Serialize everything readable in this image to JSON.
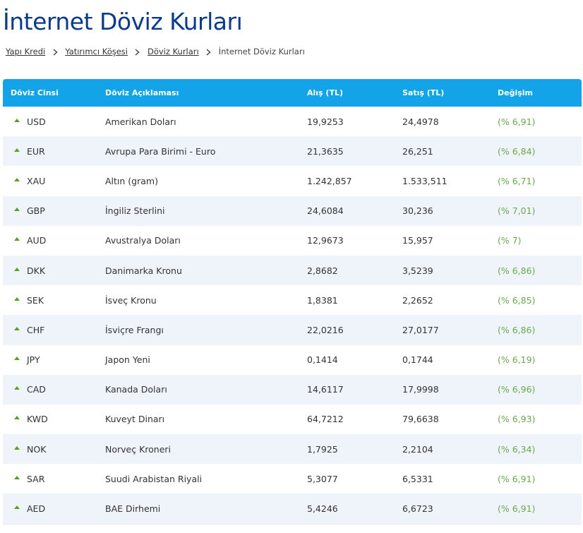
{
  "page": {
    "title": "İnternet Döviz Kurları"
  },
  "breadcrumb": {
    "items": [
      "Yapı Kredi",
      "Yatırımcı Köşesi",
      "Döviz Kurları"
    ],
    "current": "İnternet Döviz Kurları"
  },
  "table": {
    "headers": {
      "code": "Döviz Cinsi",
      "description": "Döviz Açıklaması",
      "buy": "Alış (TL)",
      "sell": "Satış (TL)",
      "change": "Değişim"
    },
    "rows": [
      {
        "code": "USD",
        "description": "Amerikan Doları",
        "buy": "19,9253",
        "sell": "24,4978",
        "change": "(% 6,91)"
      },
      {
        "code": "EUR",
        "description": "Avrupa Para Birimi - Euro",
        "buy": "21,3635",
        "sell": "26,251",
        "change": "(% 6,84)"
      },
      {
        "code": "XAU",
        "description": "Altın (gram)",
        "buy": "1.242,857",
        "sell": "1.533,511",
        "change": "(% 6,71)"
      },
      {
        "code": "GBP",
        "description": "İngiliz Sterlini",
        "buy": "24,6084",
        "sell": "30,236",
        "change": "(% 7,01)"
      },
      {
        "code": "AUD",
        "description": "Avustralya Doları",
        "buy": "12,9673",
        "sell": "15,957",
        "change": "(% 7)"
      },
      {
        "code": "DKK",
        "description": "Danimarka Kronu",
        "buy": "2,8682",
        "sell": "3,5239",
        "change": "(% 6,86)"
      },
      {
        "code": "SEK",
        "description": "İsveç Kronu",
        "buy": "1,8381",
        "sell": "2,2652",
        "change": "(% 6,85)"
      },
      {
        "code": "CHF",
        "description": "İsviçre Frangı",
        "buy": "22,0216",
        "sell": "27,0177",
        "change": "(% 6,86)"
      },
      {
        "code": "JPY",
        "description": "Japon Yeni",
        "buy": "0,1414",
        "sell": "0,1744",
        "change": "(% 6,19)"
      },
      {
        "code": "CAD",
        "description": "Kanada Doları",
        "buy": "14,6117",
        "sell": "17,9998",
        "change": "(% 6,96)"
      },
      {
        "code": "KWD",
        "description": "Kuveyt Dinarı",
        "buy": "64,7212",
        "sell": "79,6638",
        "change": "(% 6,93)"
      },
      {
        "code": "NOK",
        "description": "Norveç Kroneri",
        "buy": "1,7925",
        "sell": "2,2104",
        "change": "(% 6,34)"
      },
      {
        "code": "SAR",
        "description": "Suudi Arabistan Riyali",
        "buy": "5,3077",
        "sell": "6,5331",
        "change": "(% 6,91)"
      },
      {
        "code": "AED",
        "description": "BAE Dirhemi",
        "buy": "5,4246",
        "sell": "6,6723",
        "change": "(% 6,91)"
      }
    ]
  },
  "icons": {
    "trend": "triangle-up-icon",
    "breadcrumb_separator": "chevron-right-icon"
  },
  "colors": {
    "title": "#0a3a8c",
    "header_bg": "#12a3e8",
    "stripe": "#eef4fa",
    "up": "#5a9e2a",
    "change_text": "#6aa84f"
  }
}
